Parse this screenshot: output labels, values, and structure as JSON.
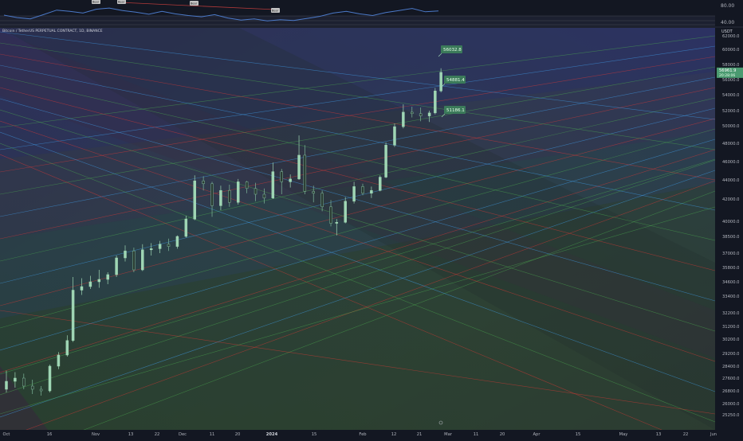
{
  "symbol": {
    "title": "Bitcoin / TetherUS PERPETUAL CONTRACT, 1D, BINANCE",
    "quote_currency": "USDT"
  },
  "indicator": {
    "levels": [
      "80.00",
      "40.00"
    ],
    "divergence_labels": [
      "Bear",
      "Bear",
      "Bear",
      "Bear"
    ],
    "rsi_series": [
      61,
      55,
      52,
      62,
      73,
      70,
      66,
      75,
      78,
      72,
      68,
      63,
      70,
      64,
      60,
      57,
      62,
      54,
      49,
      52,
      47,
      50,
      48,
      53,
      58,
      66,
      70,
      64,
      60,
      67,
      72,
      77,
      69,
      71
    ]
  },
  "main_chart": {
    "price_ticks": [
      "62000.0",
      "60000.0",
      "58000.0",
      "56000.0",
      "54000.0",
      "52000.0",
      "50000.0",
      "48000.0",
      "46000.0",
      "44000.0",
      "42000.0",
      "40000.0",
      "38500.0",
      "37000.0",
      "35800.0",
      "34600.0",
      "33400.0",
      "32200.0",
      "31200.0",
      "30200.0",
      "29200.0",
      "28400.0",
      "27600.0",
      "26800.0",
      "26000.0",
      "25250.0"
    ],
    "current_price": "56961.9",
    "current_price_sub": "20:28:06",
    "annotations": [
      {
        "label": "56032.8",
        "price": 56032.8
      },
      {
        "label": "54881.4",
        "price": 54881.4
      },
      {
        "label": "51186.1",
        "price": 51186.1
      }
    ],
    "date_ticks": [
      "Oct",
      "16",
      "Nov",
      "13",
      "22",
      "Dec",
      "11",
      "20",
      "2024",
      "15",
      "Feb",
      "12",
      "21",
      "Mar",
      "11",
      "20",
      "Apr",
      "15",
      "May",
      "13",
      "22",
      "Jun"
    ],
    "bold_date": "2024",
    "colors": {
      "background": "#131722",
      "candle_up": "#26a69a",
      "candle_color": "#9fd6b4",
      "label_bg": "#3b7a5a",
      "price_tag_bg": "#4a9a70",
      "fan_green": "#4caf50",
      "fan_red": "#e53935",
      "fan_blue": "#42a5f5"
    }
  },
  "chart_data": {
    "type": "candlestick",
    "title": "Bitcoin / TetherUS PERPETUAL CONTRACT, 1D, BINANCE",
    "ylim": [
      25250,
      62000
    ],
    "candles": [
      {
        "date": "2023-10-01",
        "o": 26900,
        "h": 28100,
        "l": 26700,
        "c": 27400
      },
      {
        "date": "2023-10-04",
        "o": 27400,
        "h": 28000,
        "l": 27000,
        "c": 27600
      },
      {
        "date": "2023-10-07",
        "o": 27600,
        "h": 27900,
        "l": 26900,
        "c": 27100
      },
      {
        "date": "2023-10-10",
        "o": 27100,
        "h": 27500,
        "l": 26600,
        "c": 26900
      },
      {
        "date": "2023-10-13",
        "o": 26900,
        "h": 27100,
        "l": 26500,
        "c": 26800
      },
      {
        "date": "2023-10-16",
        "o": 26800,
        "h": 28500,
        "l": 26700,
        "c": 28400
      },
      {
        "date": "2023-10-19",
        "o": 28400,
        "h": 29300,
        "l": 28200,
        "c": 29100
      },
      {
        "date": "2023-10-22",
        "o": 29100,
        "h": 30500,
        "l": 29000,
        "c": 30100
      },
      {
        "date": "2023-10-24",
        "o": 30100,
        "h": 35000,
        "l": 30000,
        "c": 33900
      },
      {
        "date": "2023-10-27",
        "o": 33900,
        "h": 34900,
        "l": 33500,
        "c": 34200
      },
      {
        "date": "2023-10-30",
        "o": 34200,
        "h": 35100,
        "l": 34000,
        "c": 34600
      },
      {
        "date": "2023-11-02",
        "o": 34600,
        "h": 35600,
        "l": 34100,
        "c": 34800
      },
      {
        "date": "2023-11-05",
        "o": 34800,
        "h": 35400,
        "l": 34400,
        "c": 35200
      },
      {
        "date": "2023-11-08",
        "o": 35200,
        "h": 36800,
        "l": 35000,
        "c": 36600
      },
      {
        "date": "2023-11-11",
        "o": 36600,
        "h": 37700,
        "l": 36300,
        "c": 37200
      },
      {
        "date": "2023-11-14",
        "o": 37200,
        "h": 37500,
        "l": 35400,
        "c": 35600
      },
      {
        "date": "2023-11-17",
        "o": 35600,
        "h": 37800,
        "l": 35500,
        "c": 37300
      },
      {
        "date": "2023-11-20",
        "o": 37300,
        "h": 37900,
        "l": 36800,
        "c": 37400
      },
      {
        "date": "2023-11-23",
        "o": 37400,
        "h": 38100,
        "l": 37000,
        "c": 37800
      },
      {
        "date": "2023-11-26",
        "o": 37800,
        "h": 38300,
        "l": 37200,
        "c": 37600
      },
      {
        "date": "2023-11-29",
        "o": 37600,
        "h": 38600,
        "l": 37400,
        "c": 38500
      },
      {
        "date": "2023-12-02",
        "o": 38500,
        "h": 40500,
        "l": 38400,
        "c": 40200
      },
      {
        "date": "2023-12-05",
        "o": 40200,
        "h": 44500,
        "l": 40100,
        "c": 43900
      },
      {
        "date": "2023-12-08",
        "o": 43900,
        "h": 44400,
        "l": 42900,
        "c": 43600
      },
      {
        "date": "2023-12-11",
        "o": 43600,
        "h": 43800,
        "l": 40400,
        "c": 41400
      },
      {
        "date": "2023-12-14",
        "o": 41400,
        "h": 43400,
        "l": 41000,
        "c": 42900
      },
      {
        "date": "2023-12-17",
        "o": 42900,
        "h": 43500,
        "l": 41300,
        "c": 41700
      },
      {
        "date": "2023-12-20",
        "o": 41700,
        "h": 44100,
        "l": 41500,
        "c": 43800
      },
      {
        "date": "2023-12-23",
        "o": 43800,
        "h": 43900,
        "l": 42600,
        "c": 43100
      },
      {
        "date": "2023-12-26",
        "o": 43100,
        "h": 43700,
        "l": 41800,
        "c": 42500
      },
      {
        "date": "2023-12-29",
        "o": 42500,
        "h": 43100,
        "l": 41600,
        "c": 42100
      },
      {
        "date": "2024-01-01",
        "o": 42100,
        "h": 45900,
        "l": 42000,
        "c": 44900
      },
      {
        "date": "2024-01-04",
        "o": 44900,
        "h": 45200,
        "l": 42500,
        "c": 43800
      },
      {
        "date": "2024-01-07",
        "o": 43800,
        "h": 44600,
        "l": 43200,
        "c": 44100
      },
      {
        "date": "2024-01-10",
        "o": 44100,
        "h": 48900,
        "l": 44000,
        "c": 46700
      },
      {
        "date": "2024-01-12",
        "o": 46700,
        "h": 47800,
        "l": 42500,
        "c": 42800
      },
      {
        "date": "2024-01-15",
        "o": 42800,
        "h": 43400,
        "l": 41700,
        "c": 42600
      },
      {
        "date": "2024-01-18",
        "o": 42600,
        "h": 42900,
        "l": 40900,
        "c": 41300
      },
      {
        "date": "2024-01-21",
        "o": 41300,
        "h": 41900,
        "l": 39500,
        "c": 39800
      },
      {
        "date": "2024-01-23",
        "o": 39800,
        "h": 40200,
        "l": 38600,
        "c": 39900
      },
      {
        "date": "2024-01-26",
        "o": 39900,
        "h": 42200,
        "l": 39800,
        "c": 41800
      },
      {
        "date": "2024-01-29",
        "o": 41800,
        "h": 43800,
        "l": 41600,
        "c": 43300
      },
      {
        "date": "2024-02-01",
        "o": 43300,
        "h": 43600,
        "l": 42400,
        "c": 42600
      },
      {
        "date": "2024-02-04",
        "o": 42600,
        "h": 43300,
        "l": 42100,
        "c": 42900
      },
      {
        "date": "2024-02-07",
        "o": 42900,
        "h": 44500,
        "l": 42800,
        "c": 44300
      },
      {
        "date": "2024-02-09",
        "o": 44300,
        "h": 48100,
        "l": 44200,
        "c": 47800
      },
      {
        "date": "2024-02-12",
        "o": 47800,
        "h": 50300,
        "l": 47600,
        "c": 49900
      },
      {
        "date": "2024-02-15",
        "o": 49900,
        "h": 52800,
        "l": 49700,
        "c": 51800
      },
      {
        "date": "2024-02-18",
        "o": 51800,
        "h": 52500,
        "l": 51100,
        "c": 51600
      },
      {
        "date": "2024-02-21",
        "o": 51600,
        "h": 52400,
        "l": 50600,
        "c": 51300
      },
      {
        "date": "2024-02-24",
        "o": 51300,
        "h": 52000,
        "l": 50500,
        "c": 51700
      },
      {
        "date": "2024-02-26",
        "o": 51700,
        "h": 54900,
        "l": 51500,
        "c": 54500
      },
      {
        "date": "2024-02-28",
        "o": 54500,
        "h": 57500,
        "l": 54300,
        "c": 56961.9
      }
    ]
  }
}
